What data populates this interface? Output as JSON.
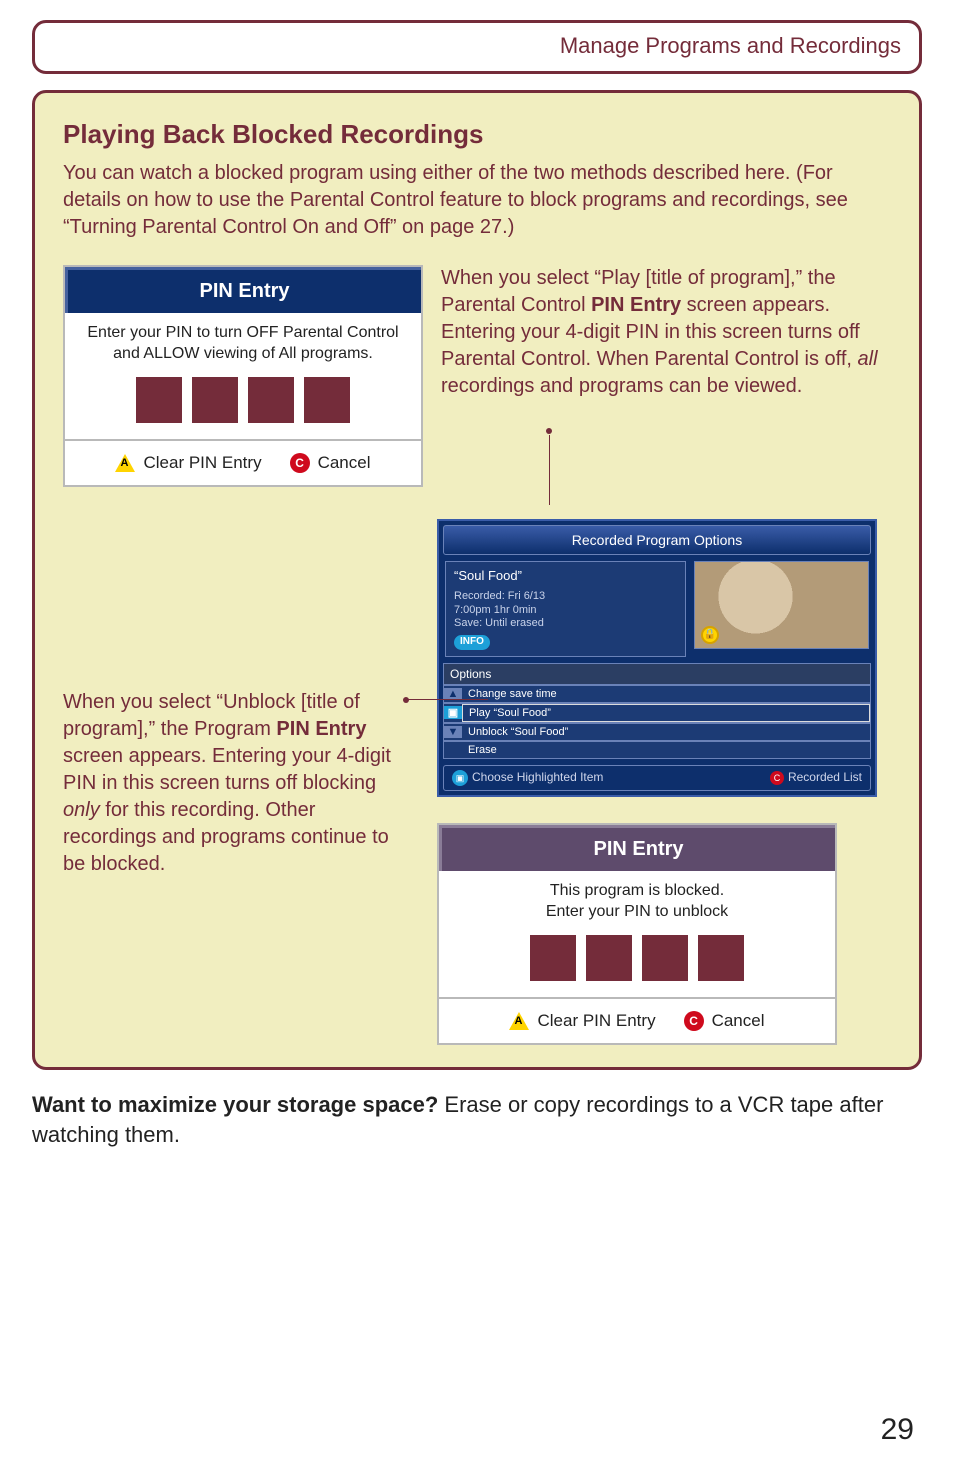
{
  "header": {
    "title": "Manage Programs and Recordings"
  },
  "section": {
    "title": "Playing Back Blocked Recordings",
    "intro": "You can watch a blocked program using either of the two methods described here. (For details on how to use the Parental Control feature to block programs and recordings, see “Turning Parental Control On and Off” on page 27.)"
  },
  "pin1": {
    "title": "PIN Entry",
    "instruction1": "Enter your PIN to turn OFF Parental Control",
    "instruction2": "and ALLOW viewing of All programs.",
    "clear": "Clear PIN Entry",
    "cancel": "Cancel"
  },
  "caption1_pre": "When you select “Play [title of program],” the Parental Control ",
  "caption1_bold": "PIN Entry",
  "caption1_post": " screen appears. Entering your 4-digit PIN in this screen turns off Parental Control. When Parental Control is off, ",
  "caption1_ital": "all",
  "caption1_end": " recordings and programs can be viewed.",
  "caption2_pre": "When you select “Unblock [title of program],” the Program ",
  "caption2_bold": "PIN Entry",
  "caption2_post": " screen appears. Entering your 4-digit PIN in this screen turns off blocking ",
  "caption2_ital": "only",
  "caption2_end": " for this recording. Other recordings and programs continue to be blocked.",
  "dvr": {
    "title": "Recorded Program Options",
    "program": "“Soul Food”",
    "rec_line1": "Recorded: Fri  6/13",
    "rec_line2": "7:00pm  1hr  0min",
    "rec_line3": "Save: Until erased",
    "info": "INFO",
    "options_head": "Options",
    "o1": "Change save time",
    "o2": "Play “Soul Food”",
    "o3": "Unblock “Soul Food”",
    "o4": "Erase",
    "footer_left": "Choose Highlighted Item",
    "footer_right": "Recorded List"
  },
  "pin2": {
    "title": "PIN Entry",
    "l1": "This program is blocked.",
    "l2": "Enter your PIN to unblock",
    "clear": "Clear PIN Entry",
    "cancel": "Cancel"
  },
  "footnote_bold": "Want to maximize your storage space?",
  "footnote_rest": " Erase or copy recordings to a VCR tape after watching them.",
  "page_number": "29"
}
